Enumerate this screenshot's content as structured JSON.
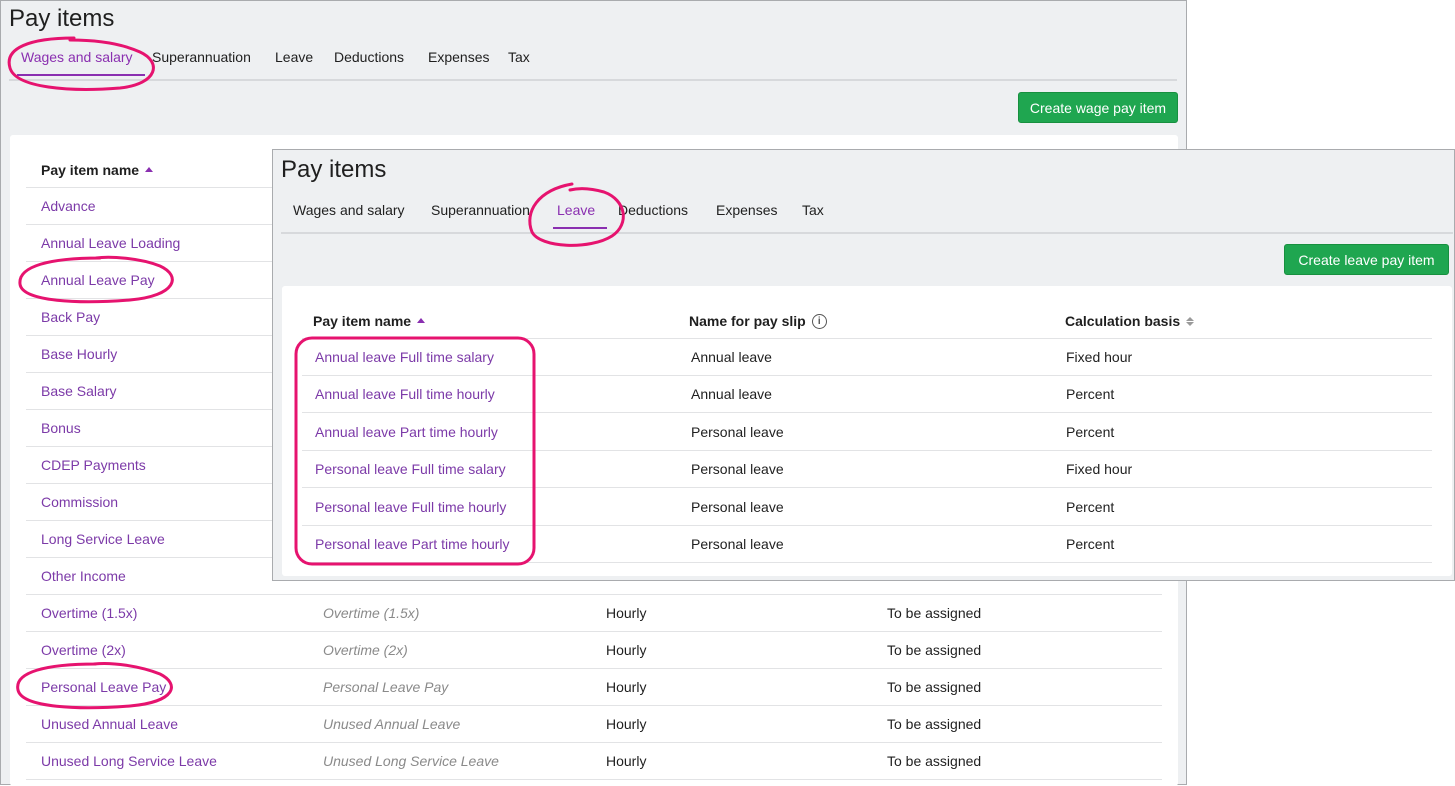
{
  "back": {
    "title": "Pay items",
    "tabs": [
      "Wages and salary",
      "Superannuation",
      "Leave",
      "Deductions",
      "Expenses",
      "Tax"
    ],
    "active_tab": "Wages and salary",
    "create_button": "Create wage pay item",
    "table": {
      "header_name": "Pay item name",
      "rows": [
        {
          "name": "Advance",
          "slip": "",
          "type": "",
          "status": ""
        },
        {
          "name": "Annual Leave Loading",
          "slip": "",
          "type": "",
          "status": ""
        },
        {
          "name": "Annual Leave Pay",
          "slip": "",
          "type": "",
          "status": ""
        },
        {
          "name": "Back Pay",
          "slip": "",
          "type": "",
          "status": ""
        },
        {
          "name": "Base Hourly",
          "slip": "",
          "type": "",
          "status": ""
        },
        {
          "name": "Base Salary",
          "slip": "",
          "type": "",
          "status": ""
        },
        {
          "name": "Bonus",
          "slip": "",
          "type": "",
          "status": ""
        },
        {
          "name": "CDEP Payments",
          "slip": "",
          "type": "",
          "status": ""
        },
        {
          "name": "Commission",
          "slip": "",
          "type": "",
          "status": ""
        },
        {
          "name": "Long Service Leave",
          "slip": "",
          "type": "",
          "status": ""
        },
        {
          "name": "Other Income",
          "slip": "",
          "type": "",
          "status": ""
        },
        {
          "name": "Overtime (1.5x)",
          "slip": "Overtime (1.5x)",
          "type": "Hourly",
          "status": "To be assigned"
        },
        {
          "name": "Overtime (2x)",
          "slip": "Overtime (2x)",
          "type": "Hourly",
          "status": "To be assigned"
        },
        {
          "name": "Personal Leave Pay",
          "slip": "Personal Leave Pay",
          "type": "Hourly",
          "status": "To be assigned"
        },
        {
          "name": "Unused Annual Leave",
          "slip": "Unused Annual Leave",
          "type": "Hourly",
          "status": "To be assigned"
        },
        {
          "name": "Unused Long Service Leave",
          "slip": "Unused Long Service Leave",
          "type": "Hourly",
          "status": "To be assigned"
        }
      ]
    }
  },
  "front": {
    "title": "Pay items",
    "tabs": [
      "Wages and salary",
      "Superannuation",
      "Leave",
      "Deductions",
      "Expenses",
      "Tax"
    ],
    "active_tab": "Leave",
    "create_button": "Create leave pay item",
    "table": {
      "header_name": "Pay item name",
      "header_slip": "Name for pay slip",
      "header_basis": "Calculation basis",
      "rows": [
        {
          "name": "Annual leave Full time salary",
          "slip": "Annual leave",
          "basis": "Fixed hour"
        },
        {
          "name": "Annual leave Full time hourly",
          "slip": "Annual leave",
          "basis": "Percent"
        },
        {
          "name": "Annual leave Part time hourly",
          "slip": "Personal leave",
          "basis": "Percent"
        },
        {
          "name": "Personal leave Full time salary",
          "slip": "Personal leave",
          "basis": "Fixed hour"
        },
        {
          "name": "Personal leave Full time hourly",
          "slip": "Personal leave",
          "basis": "Percent"
        },
        {
          "name": "Personal leave Part time hourly",
          "slip": "Personal leave",
          "basis": "Percent"
        }
      ]
    }
  },
  "colors": {
    "accent": "#8a2fb0",
    "link": "#7c3aa8",
    "button": "#1fa650",
    "highlight": "#e6136f"
  },
  "icons": {
    "sort": "caret-up-icon",
    "sort_both": "sort-icon",
    "info": "info-icon"
  }
}
